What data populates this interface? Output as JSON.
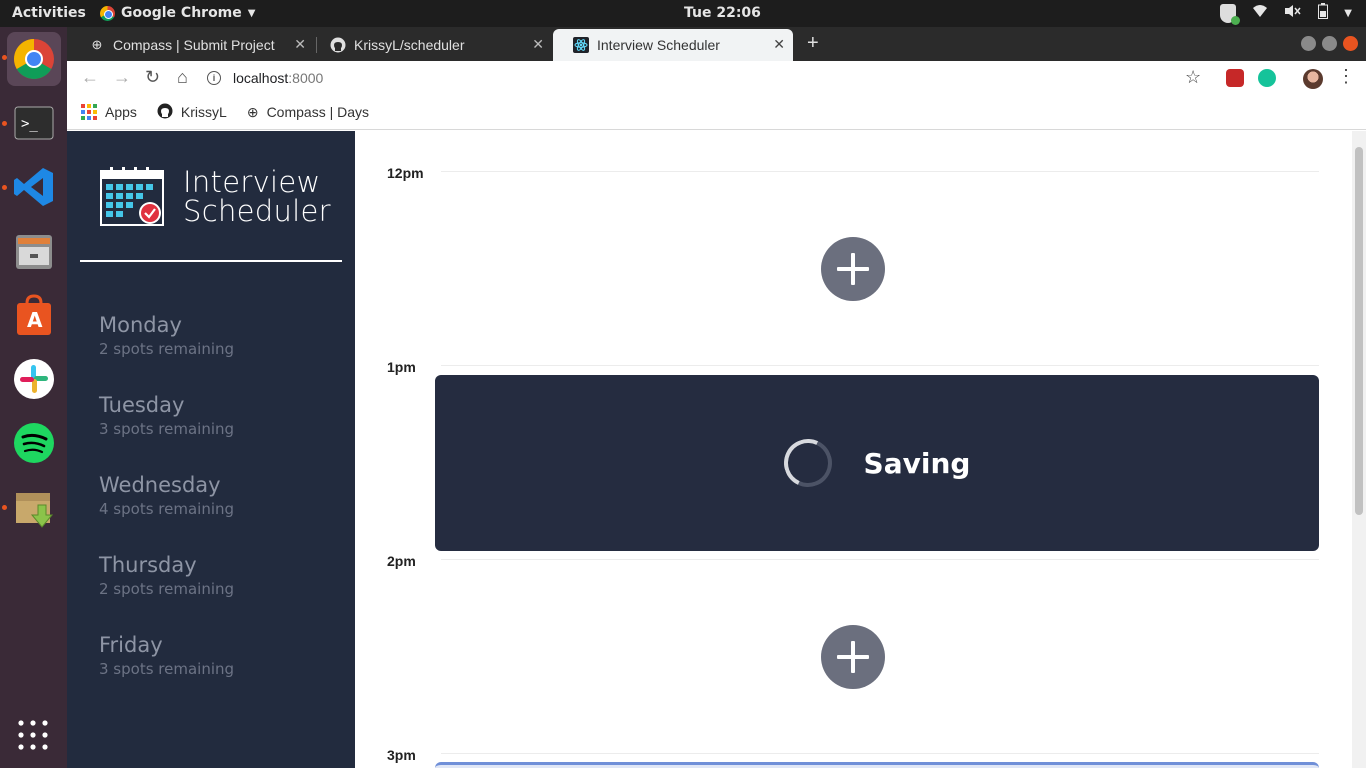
{
  "system": {
    "activities": "Activities",
    "app_name": "Google Chrome",
    "clock": "Tue 22:06"
  },
  "browser": {
    "tabs": [
      {
        "label": "Compass | Submit Project",
        "active": false
      },
      {
        "label": "KrissyL/scheduler",
        "active": false
      },
      {
        "label": "Interview Scheduler",
        "active": true
      }
    ],
    "url_host": "localhost",
    "url_port": ":8000",
    "bookmarks": [
      {
        "label": "Apps",
        "icon": "apps-grid-icon"
      },
      {
        "label": "KrissyL",
        "icon": "github-icon"
      },
      {
        "label": "Compass | Days",
        "icon": "compass-icon"
      }
    ]
  },
  "app": {
    "logo_line1": "Interview",
    "logo_line2": "Scheduler",
    "days": [
      {
        "name": "Monday",
        "spots": "2 spots remaining"
      },
      {
        "name": "Tuesday",
        "spots": "3 spots remaining"
      },
      {
        "name": "Wednesday",
        "spots": "4 spots remaining"
      },
      {
        "name": "Thursday",
        "spots": "2 spots remaining"
      },
      {
        "name": "Friday",
        "spots": "3 spots remaining"
      }
    ],
    "hours": [
      "12pm",
      "1pm",
      "2pm",
      "3pm"
    ],
    "saving_label": "Saving"
  },
  "colors": {
    "sidebar_bg": "#222b3e",
    "card_bg": "#252c40",
    "add_button": "#6b6f7e",
    "ubuntu_orange": "#e95420"
  }
}
